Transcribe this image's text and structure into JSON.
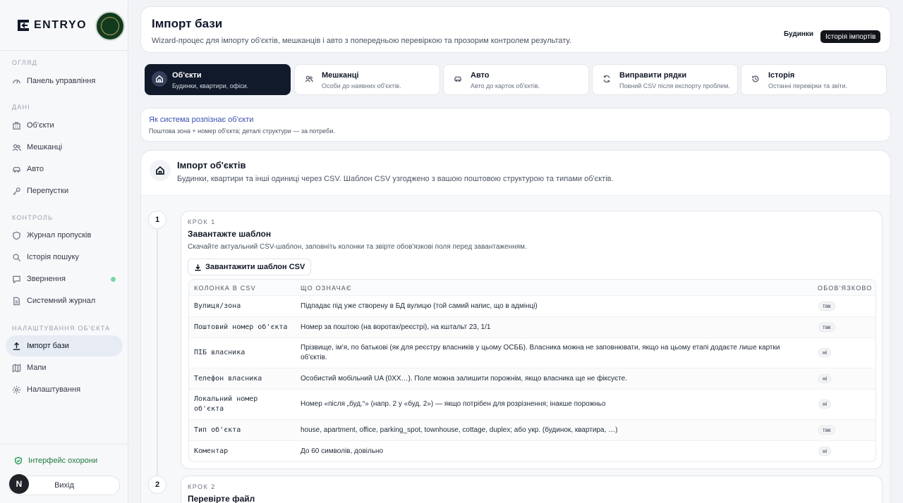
{
  "brand": {
    "name": "ENTRYO"
  },
  "sidebar": {
    "sections": [
      {
        "title": "ОГЛЯД"
      },
      {
        "title": "ДАНІ"
      },
      {
        "title": "КОНТРОЛЬ"
      },
      {
        "title": "НАЛАШТУВАННЯ ОБ'ЄКТА"
      }
    ],
    "items": [
      {
        "label": "Панель управління",
        "icon": "gauge-icon"
      },
      {
        "label": "Об'єкти",
        "icon": "building-icon"
      },
      {
        "label": "Мешканці",
        "icon": "users-icon"
      },
      {
        "label": "Авто",
        "icon": "car-icon"
      },
      {
        "label": "Перепустки",
        "icon": "key-icon"
      },
      {
        "label": "Журнал пропусків",
        "icon": "shield-icon"
      },
      {
        "label": "Історія пошуку",
        "icon": "search-icon"
      },
      {
        "label": "Звернення",
        "icon": "message-icon"
      },
      {
        "label": "Системний журнал",
        "icon": "document-icon"
      },
      {
        "label": "Імпорт бази",
        "icon": "upload-icon"
      },
      {
        "label": "Мапи",
        "icon": "map-icon"
      },
      {
        "label": "Налаштування",
        "icon": "gear-icon"
      }
    ],
    "guard_label": "Інтерфейс охорони",
    "logout_label": "Вихід",
    "user_initial": "N",
    "notification_color": "#7ad7a4"
  },
  "header": {
    "title": "Імпорт бази",
    "subtitle": "Wizard-процес для імпорту об'єктів, мешканців і авто з попередньою перевіркою та прозорим контролем результату.",
    "buildings_label": "Будинки",
    "history_label": "Історія імпортів"
  },
  "tabs": [
    {
      "title": "Об'єкти",
      "subtitle": "Будинки, квартири, офіси.",
      "icon": "home-icon"
    },
    {
      "title": "Мешканці",
      "subtitle": "Особи до наявних об'єктів.",
      "icon": "users-icon"
    },
    {
      "title": "Авто",
      "subtitle": "Авто до карток об'єктів.",
      "icon": "car-icon"
    },
    {
      "title": "Виправити рядки",
      "subtitle": "Повний CSV після експорту проблем.",
      "icon": "refresh-icon"
    },
    {
      "title": "Історія",
      "subtitle": "Останні перевірки та звіти.",
      "icon": "history-icon"
    }
  ],
  "info": {
    "title": "Як система розпізнає об'єкти",
    "subtitle": "Поштова зона + номер об'єкта; деталі структури — за потреби."
  },
  "import": {
    "title": "Імпорт об'єктів",
    "subtitle": "Будинки, квартири та інші одиниці через CSV. Шаблон CSV узгоджено з вашою поштовою структурою та типами об'єктів."
  },
  "steps": [
    {
      "number": "1",
      "kicker": "КРОК 1",
      "title": "Завантажте шаблон",
      "subtitle": "Скачайте актуальний CSV-шаблон, заповніть колонки та звірте обов'язкові поля перед завантаженням.",
      "button": "Завантажити шаблон CSV"
    },
    {
      "number": "2",
      "kicker": "КРОК 2",
      "title": "Перевірте файл"
    }
  ],
  "table": {
    "headers": [
      "КОЛОНКА В CSV",
      "ЩО ОЗНАЧАЄ",
      "ОБОВ'ЯЗКОВО"
    ],
    "rows": [
      {
        "col": "Вулиця/зона",
        "desc": "Підпадає під уже створену в БД вулицю (той самий напис, що в адмінці)",
        "req": "так"
      },
      {
        "col": "Поштовий номер об'єкта",
        "desc": "Номер за поштою (на воротах/реєстрі), на кштальт 23, 1/1",
        "req": "так"
      },
      {
        "col": "ПІБ власника",
        "desc": "Прізвище, ім'я, по батькові (як для реєстру власників у цьому ОСББ). Власника можна не заповнювати, якщо на цьому етапі додаєте лише картки об'єктів.",
        "req": "ні"
      },
      {
        "col": "Телефон власника",
        "desc": "Особистий мобільний UA (0XX…). Поле можна залишити порожнім, якщо власника ще не фіксуєте.",
        "req": "ні"
      },
      {
        "col": "Локальний номер об'єкта",
        "desc": "Номер «після „буд.“» (напр. 2 у «буд. 2») — якщо потрібен для розрізнення; інакше порожньо",
        "req": "ні"
      },
      {
        "col": "Тип об'єкта",
        "desc": "house, apartment, office, parking_spot, townhouse, cottage, duplex; або укр. (будинок, квартира, …)",
        "req": "так"
      },
      {
        "col": "Коментар",
        "desc": "До 60 символів, довільно",
        "req": "ні"
      }
    ]
  }
}
